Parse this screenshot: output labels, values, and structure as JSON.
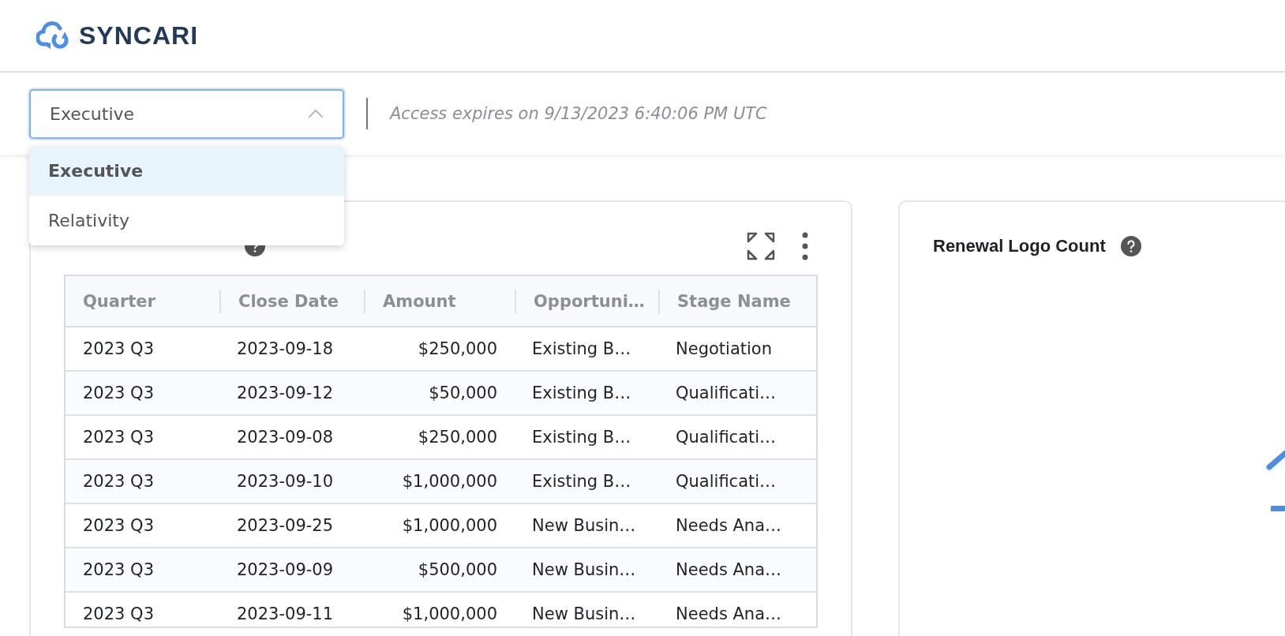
{
  "header": {
    "logo_text": "SYNCARI"
  },
  "toolbar": {
    "select": {
      "value": "Executive",
      "expanded": true,
      "options": [
        {
          "label": "Executive",
          "selected": true
        },
        {
          "label": "Relativity",
          "selected": false
        }
      ]
    },
    "access_note": "Access expires on 9/13/2023 6:40:06 PM UTC"
  },
  "cards": [
    {
      "kind": "table",
      "table": {
        "columns": [
          "Quarter",
          "Close Date",
          "Amount",
          "Opportuni…",
          "Stage Name"
        ],
        "rows": [
          [
            "2023 Q3",
            "2023-09-18",
            "$250,000",
            "Existing B…",
            "Negotiation"
          ],
          [
            "2023 Q3",
            "2023-09-12",
            "$50,000",
            "Existing B…",
            "Qualificati…"
          ],
          [
            "2023 Q3",
            "2023-09-08",
            "$250,000",
            "Existing B…",
            "Qualificati…"
          ],
          [
            "2023 Q3",
            "2023-09-10",
            "$1,000,000",
            "Existing B…",
            "Qualificati…"
          ],
          [
            "2023 Q3",
            "2023-09-25",
            "$1,000,000",
            "New Busin…",
            "Needs Ana…"
          ],
          [
            "2023 Q3",
            "2023-09-09",
            "$500,000",
            "New Busin…",
            "Needs Ana…"
          ],
          [
            "2023 Q3",
            "2023-09-11",
            "$1,000,000",
            "New Busin…",
            "Needs Ana…"
          ]
        ]
      }
    },
    {
      "kind": "metric",
      "title": "Renewal Logo Count"
    }
  ]
}
